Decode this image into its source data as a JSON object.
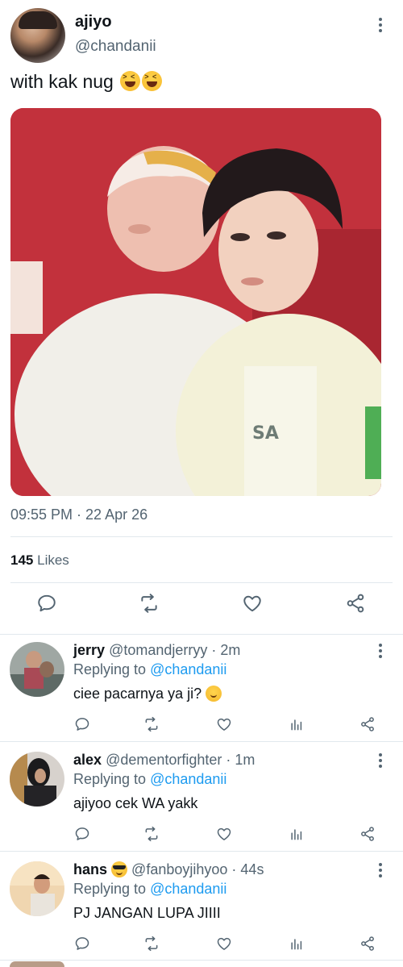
{
  "tweet": {
    "display_name": "ajiyo",
    "handle": "@chandanii",
    "text": "with kak nug",
    "emojis": [
      "laughing-squint-emoji",
      "laughing-squint-emoji"
    ],
    "timestamp": "09:55 PM · 22 Apr 26",
    "likes_count": "145",
    "likes_label": "Likes",
    "actions": [
      "reply-icon",
      "retweet-icon",
      "like-icon",
      "share-icon"
    ]
  },
  "replies": [
    {
      "display_name": "jerry",
      "handle": "@tomandjerryy",
      "time": "· 2m",
      "replying_prefix": "Replying to",
      "replying_to": "@chandanii",
      "text": "ciee pacarnya ya ji?",
      "emoji": "face-with-hand-over-mouth-emoji"
    },
    {
      "display_name": "alex",
      "handle": "@dementorfighter",
      "time": "· 1m",
      "replying_prefix": "Replying to",
      "replying_to": "@chandanii",
      "text": "ajiyoo cek WA yakk"
    },
    {
      "display_name": "hans",
      "handle": "@fanboyjihyoo",
      "time": "· 44s",
      "replying_prefix": "Replying to",
      "replying_to": "@chandanii",
      "text": "PJ JANGAN LUPA JIIII",
      "emoji": "smiling-face-with-sunglasses-emoji"
    }
  ],
  "colors": {
    "link": "#1d9bf0",
    "secondary_text": "#536471",
    "primary_text": "#0f1419",
    "divider": "#e1e8ed"
  }
}
